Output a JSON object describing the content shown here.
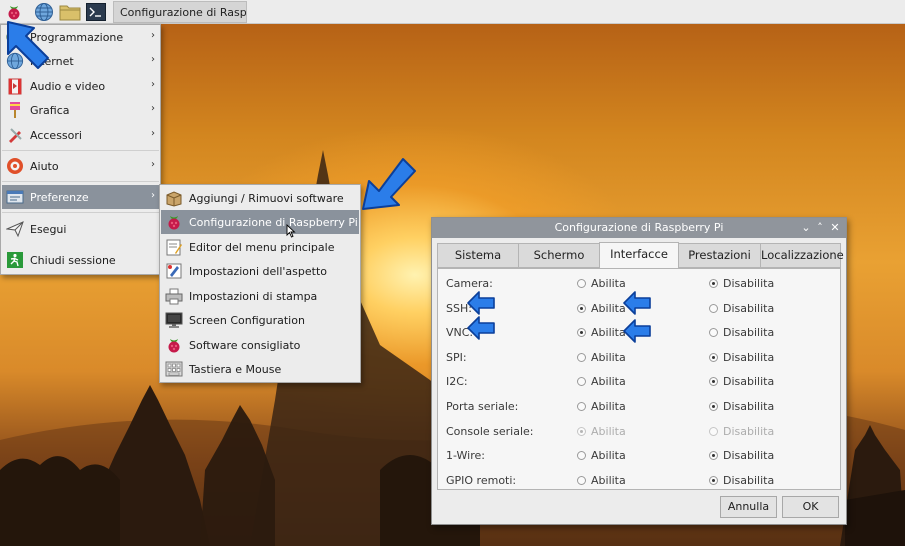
{
  "taskbar": {
    "launchers": [
      "raspberry-icon",
      "globe-icon",
      "folder-icon",
      "terminal-icon"
    ],
    "task_button": {
      "icon": "raspberry-icon",
      "label": "Configurazione di Raspberry Pi"
    }
  },
  "main_menu": {
    "items": [
      {
        "label": "Programmazione",
        "icon": "programming-icon",
        "has_submenu": true
      },
      {
        "label": "Internet",
        "icon": "globe-icon",
        "has_submenu": true
      },
      {
        "label": "Audio e video",
        "icon": "media-icon",
        "has_submenu": true
      },
      {
        "label": "Grafica",
        "icon": "graphics-icon",
        "has_submenu": true
      },
      {
        "label": "Accessori",
        "icon": "accessories-icon",
        "has_submenu": true
      },
      {
        "label": "Aiuto",
        "icon": "help-icon",
        "has_submenu": true
      },
      {
        "label": "Preferenze",
        "icon": "preferences-icon",
        "has_submenu": true,
        "highlighted": true
      },
      {
        "label": "Esegui",
        "icon": "run-icon",
        "has_submenu": false
      },
      {
        "label": "Chiudi sessione",
        "icon": "logout-icon",
        "has_submenu": false
      }
    ]
  },
  "preferences_menu": {
    "items": [
      {
        "label": "Aggiungi / Rimuovi software",
        "icon": "package-icon"
      },
      {
        "label": "Configurazione di Raspberry Pi",
        "icon": "raspberry-icon",
        "highlighted": true
      },
      {
        "label": "Editor del menu principale",
        "icon": "menu-editor-icon"
      },
      {
        "label": "Impostazioni dell'aspetto",
        "icon": "appearance-icon"
      },
      {
        "label": "Impostazioni di stampa",
        "icon": "printer-icon"
      },
      {
        "label": "Screen Configuration",
        "icon": "monitor-icon"
      },
      {
        "label": "Software consigliato",
        "icon": "raspberry-icon"
      },
      {
        "label": "Tastiera e Mouse",
        "icon": "keyboard-icon"
      }
    ]
  },
  "dialog": {
    "title": "Configurazione di Raspberry Pi",
    "controls": [
      "chevron-down-icon",
      "chevron-up-icon",
      "close-icon"
    ],
    "tabs": [
      {
        "label": "Sistema"
      },
      {
        "label": "Schermo"
      },
      {
        "label": "Interfacce",
        "active": true
      },
      {
        "label": "Prestazioni"
      },
      {
        "label": "Localizzazione"
      }
    ],
    "enable_label": "Abilita",
    "disable_label": "Disabilita",
    "rows": [
      {
        "label": "Camera:",
        "value": "Disabilita",
        "disabled": false
      },
      {
        "label": "SSH:",
        "value": "Abilita",
        "disabled": false
      },
      {
        "label": "VNC:",
        "value": "Abilita",
        "disabled": false
      },
      {
        "label": "SPI:",
        "value": "Disabilita",
        "disabled": false
      },
      {
        "label": "I2C:",
        "value": "Disabilita",
        "disabled": false
      },
      {
        "label": "Porta seriale:",
        "value": "Disabilita",
        "disabled": false
      },
      {
        "label": "Console seriale:",
        "value": "Abilita",
        "disabled": true
      },
      {
        "label": "1-Wire:",
        "value": "Disabilita",
        "disabled": false
      },
      {
        "label": "GPIO remoti:",
        "value": "Disabilita",
        "disabled": false
      }
    ],
    "buttons": {
      "cancel": "Annulla",
      "ok": "OK"
    }
  },
  "colors": {
    "menu_highlight": "#8a929c",
    "title_bar": "#90959c",
    "annotation_arrow": "#1d6fe0"
  }
}
